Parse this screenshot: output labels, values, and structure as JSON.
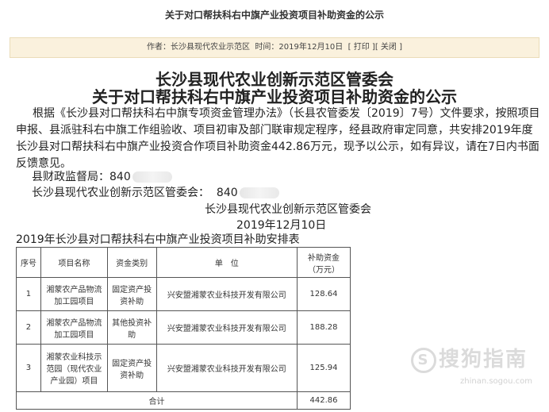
{
  "header": {
    "title": "关于对口帮扶科右中旗产业投资项目补助资金的公示"
  },
  "meta": {
    "author_label": "作者：",
    "author": "长沙县现代农业示范区",
    "time_label": "时间：",
    "time": "2019年12月10日",
    "print_label": "[ 打印 ]",
    "close_label": "[ 关闭 ]"
  },
  "article": {
    "title_line1": "长沙县现代农业创新示范区管委会",
    "title_line2": "关于对口帮扶科右中旗产业投资项目补助资金的公示",
    "body": "根据《长沙县对口帮扶科右中旗专项资金管理办法》（长县农管委发〔2019〕7号）文件要求，按照项目申报、县派驻科右中旗工作组验收、项目初审及部门联审规定程序，经县政府审定同意，共安排2019年度长沙县对口帮扶科右中旗产业投资合作项目补助资金442.86万元，现予以公示，如有异议，请在7日内书面反馈意见。",
    "contact1_label": "县财政监督局：",
    "contact1_value": "840",
    "contact2_label": "长沙县现代农业创新示范区管委会：",
    "contact2_value": "840",
    "sign_org": "长沙县现代农业创新示范区管委会",
    "sign_date": "2019年12月10日"
  },
  "table": {
    "title": "2019年长沙县对口帮扶科右中旗产业投资项目补助安排表",
    "headers": {
      "no": "序号",
      "project": "项目名称",
      "category": "资金类别",
      "unit": "单　位",
      "amount_line1": "补助资金",
      "amount_line2": "（万元）"
    },
    "rows": [
      {
        "no": "1",
        "project": "湘蒙农产品物流加工园项目",
        "category": "固定资产投资补助",
        "unit": "兴安盟湘蒙农业科技开发有限公司",
        "amount": "128.64"
      },
      {
        "no": "2",
        "project": "湘蒙农产品物流加工园项目",
        "category": "其他投资补助",
        "unit": "兴安盟湘蒙农业科技开发有限公司",
        "amount": "188.28"
      },
      {
        "no": "3",
        "project": "湘蒙农业科技示范园（现代农业产业园）项目",
        "category": "固定资产投资补助",
        "unit": "兴安盟湘蒙农业科技开发有限公司",
        "amount": "125.94"
      }
    ],
    "total_label": "合计",
    "total_value": "442.86"
  },
  "watermark": {
    "text": "搜狗指南",
    "icon": "S",
    "url": "zhinan.sogou.com"
  }
}
